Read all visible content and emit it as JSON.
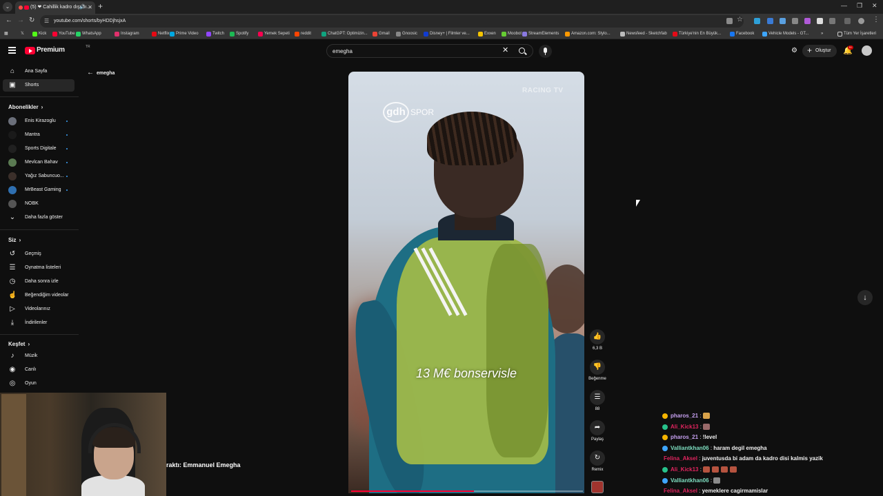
{
  "browser": {
    "tab_title": "(5) ❤ Cahillik kadro dışı bı...",
    "url": "youtube.com/shorts/byHDDjhsjxA",
    "bookmarks": [
      "Kick",
      "YouTube",
      "WhatsApp",
      "Instagram",
      "Netflix",
      "Prime Video",
      "Twitch",
      "Spotify",
      "Yemek Sepeti",
      "reddit",
      "ChatGPT: Optimizin...",
      "Gmail",
      "Gnoosic",
      "Disney+ | Filmler ve...",
      "Exxen",
      "Moobot",
      "StreamElements",
      "Amazon.com: Stylo...",
      "Newsfeed - Sketchfab",
      "Türkiye'nin En Büyük...",
      "Facebook",
      "Vehicle Models - GT..."
    ],
    "all_bookmarks": "Tüm Yer İşaretleri"
  },
  "masthead": {
    "logo_text": "Premium",
    "logo_country": "TR",
    "search_query": "emegha",
    "create_label": "Oluştur",
    "notification_count": "9+"
  },
  "sidebar": {
    "main": [
      {
        "label": "Ana Sayfa",
        "icon": "home-icon"
      },
      {
        "label": "Shorts",
        "icon": "shorts-icon"
      }
    ],
    "subscriptions_title": "Abonelikler",
    "subscriptions": [
      {
        "label": "Enis Kirazoglu",
        "color": "#6b6f7a"
      },
      {
        "label": "Mantra",
        "color": "#1a1a1a"
      },
      {
        "label": "Sports Digitale",
        "color": "#202020"
      },
      {
        "label": "Mevlcan Bahav",
        "color": "#5a7a52"
      },
      {
        "label": "Yağız Sabuncuo...",
        "color": "#3b2f2a"
      },
      {
        "label": "MrBeast Gaming",
        "color": "#2f6fb0"
      },
      {
        "label": "NOBK",
        "color": "#555555"
      }
    ],
    "show_more": "Daha fazla göster",
    "you_title": "Siz",
    "you": [
      {
        "label": "Geçmiş",
        "icon": "history-icon"
      },
      {
        "label": "Oynatma listeleri",
        "icon": "playlist-icon"
      },
      {
        "label": "Daha sonra izle",
        "icon": "watch-later-icon"
      },
      {
        "label": "Beğendiğim videolar",
        "icon": "like-icon"
      },
      {
        "label": "Videolarınız",
        "icon": "your-videos-icon"
      },
      {
        "label": "İndirilenler",
        "icon": "download-icon"
      }
    ],
    "explore_title": "Keşfet",
    "explore": [
      {
        "label": "Müzik",
        "icon": "music-icon"
      },
      {
        "label": "Canlı",
        "icon": "live-icon"
      },
      {
        "label": "Oyun",
        "icon": "gaming-icon"
      }
    ]
  },
  "short": {
    "back_label": "emegha",
    "overlay_brand": "gdh",
    "overlay_brand_suffix": "SPOR",
    "watermark": "RACING TV",
    "caption": "13 M€ bonservisle",
    "progress": 0.53
  },
  "actions": [
    {
      "name": "like",
      "glyph": "👍",
      "label": "6,3 B"
    },
    {
      "name": "dislike",
      "glyph": "👎",
      "label": "Beğenme"
    },
    {
      "name": "comments",
      "glyph": "☰",
      "label": "88"
    },
    {
      "name": "share",
      "glyph": "➦",
      "label": "Paylaş"
    },
    {
      "name": "remix",
      "glyph": "↻",
      "label": "Remix"
    }
  ],
  "stream": {
    "webcam_tag": "raktı: Emmanuel Emegha",
    "chat": [
      {
        "user": "pharos_21",
        "msg": "",
        "user_color": "#c6a0f0",
        "badge": "#f5b400",
        "emotes": [
          "#d9a24a"
        ]
      },
      {
        "user": "Ali_Kick13",
        "msg": "",
        "user_color": "#e0245e",
        "badge": "#27c28b",
        "emotes": [
          "#9a6a6a"
        ]
      },
      {
        "user": "pharos_21",
        "msg": "!level",
        "user_color": "#c6a0f0",
        "badge": "#f5b400",
        "emotes": []
      },
      {
        "user": "Valliantkhan06",
        "msg": "haram degil emegha",
        "user_color": "#7fe0c2",
        "badge": "#3ea6ff",
        "emotes": []
      },
      {
        "user": "Felina_Aksel",
        "msg": "juventusda bi adam da kadro disi kalmis yazik",
        "user_color": "#e0245e",
        "badge": "",
        "emotes": []
      },
      {
        "user": "Ali_Kick13",
        "msg": "",
        "user_color": "#e0245e",
        "badge": "#27c28b",
        "emotes": [
          "#b5533f",
          "#b5533f",
          "#b5533f",
          "#b5533f"
        ]
      },
      {
        "user": "Valliantkhan06",
        "msg": "",
        "user_color": "#7fe0c2",
        "badge": "#3ea6ff",
        "emotes": [
          "#8a8a8a"
        ]
      },
      {
        "user": "Felina_Aksel",
        "msg": "yemeklere cagirmamislar",
        "user_color": "#e0245e",
        "badge": "",
        "emotes": []
      }
    ]
  }
}
